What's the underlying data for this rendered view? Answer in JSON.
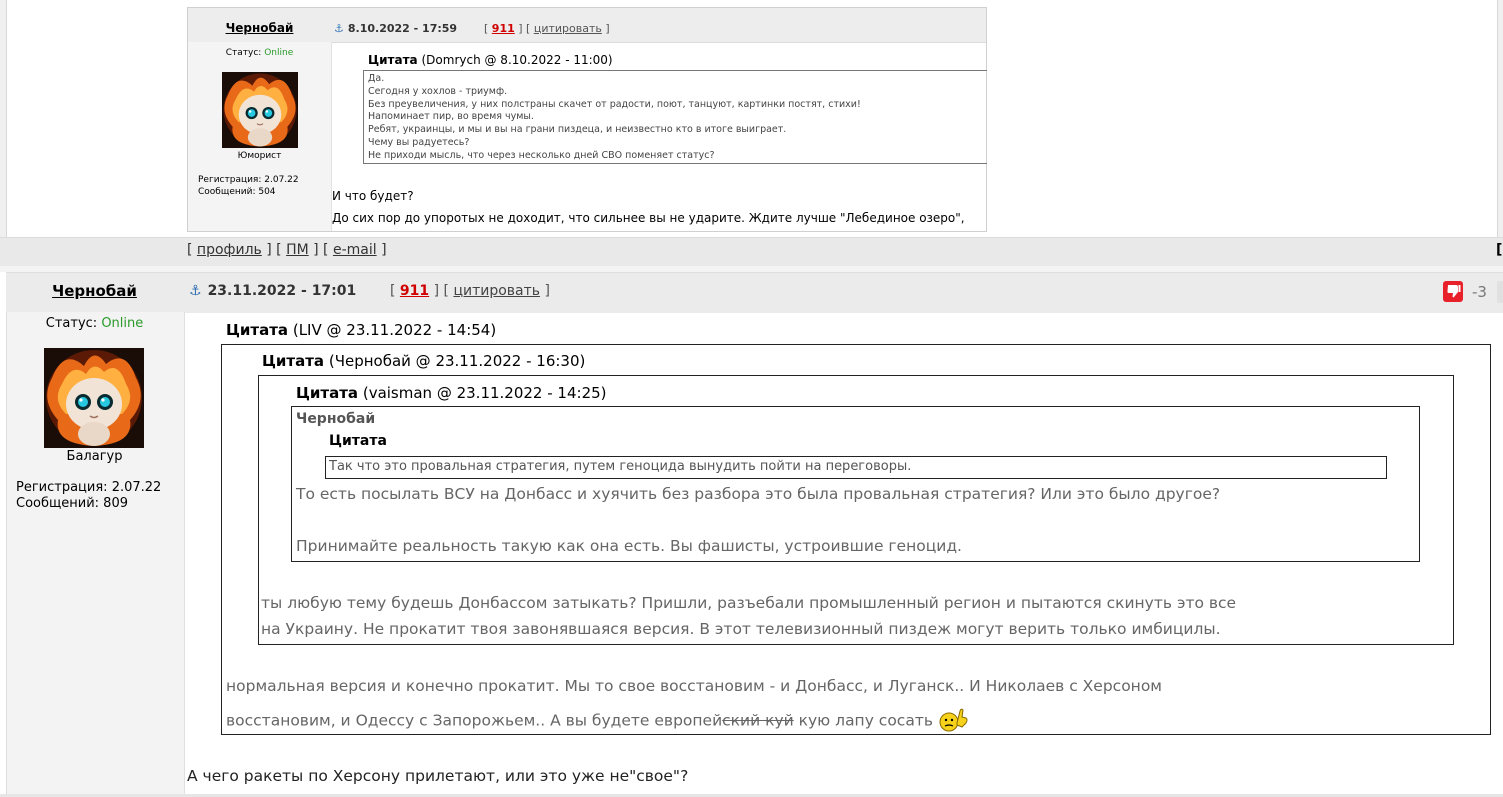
{
  "first_post": {
    "author": "Чернобай",
    "date": "8.10.2022 - 17:59",
    "link_911": "911",
    "cite_label": "цитировать",
    "status_label": "Статус:",
    "status_value": "Online",
    "rank": "Юморист",
    "reg_label": "Регистрация:",
    "reg_value": "2.07.22",
    "posts_label": "Сообщений:",
    "posts_value": "504",
    "quote_title": "Цитата",
    "quote_source": "(Domrych @ 8.10.2022 - 11:00)",
    "quote_lines": [
      "Да.",
      "Сегодня у хохлов - триумф.",
      "Без преувеличения, у них полстраны скачет от радости, поют, танцуют, картинки постят, стихи!",
      "Напоминает пир, во время чумы.",
      "Ребят, украинцы, и мы и вы на грани пиздеца, и неизвестно кто в итоге выиграет.",
      "Чему вы радуетесь?",
      "Не приходи мысль, что через несколько дней СВО поменяет статус?"
    ],
    "reply_1": "И что будет?",
    "reply_2": "До сих пор до упоротых не доходит, что сильнее вы не ударите. Ждите лучше \"Лебединое озеро\","
  },
  "footer_links": {
    "profile": "профиль",
    "pm": "ПМ",
    "email": "e-mail"
  },
  "post": {
    "author": "Чернобай",
    "date": "23.11.2022 - 17:01",
    "link_911": "911",
    "cite_label": "цитировать",
    "rating": "-3",
    "status_label": "Статус:",
    "status_value": "Online",
    "rank": "Балагур",
    "reg_label": "Регистрация:",
    "reg_value": "2.07.22",
    "posts_label": "Сообщений:",
    "posts_value": "809",
    "quotes": {
      "q1_title": "Цитата",
      "q1_source": "(LIV @ 23.11.2022 - 14:54)",
      "q2_title": "Цитата",
      "q2_source": "(Чернобай @ 23.11.2022 - 16:30)",
      "q3_title": "Цитата",
      "q3_source": "(vaisman @ 23.11.2022 - 14:25)",
      "q4_author": "Чернобай",
      "q4_title": "Цитата",
      "q4_text": "Так что это провальная стратегия, путем геноцида вынудить пойти на переговоры.",
      "q3_text_1": "То есть посылать ВСУ на Донбасс и хуячить без разбора это была провальная стратегия? Или это было другое?",
      "q3_text_2": "Принимайте реальность такую как она есть. Вы фашисты, устроившие геноцид.",
      "q2_text_1": "ты любую тему будешь Донбассом затыкать? Пришли, разъебали промышленный регион и пытаются скинуть это все",
      "q2_text_2": "на Украину. Не прокатит твоя завонявшаяся версия. В этот телевизионный пиздеж могут верить только имбицилы.",
      "q1_text_1": "нормальная версия и конечно прокатит. Мы то свое восстановим - и Донбасс, и Луганск.. И Николаев с Херсоном",
      "q1_text_2a": "восстановим, и Одессу с Запорожьем.. А вы будете европей",
      "q1_text_2_struck": "ский куй",
      "q1_text_2b": " кую лапу сосать"
    },
    "body": "А чего ракеты по Херсону прилетают, или это уже не\"свое\"?"
  },
  "colors": {
    "online": "#2a9a2a",
    "link_red": "#d00000",
    "rating_red": "#e8202a",
    "anchor_blue": "#2f6fb0"
  }
}
